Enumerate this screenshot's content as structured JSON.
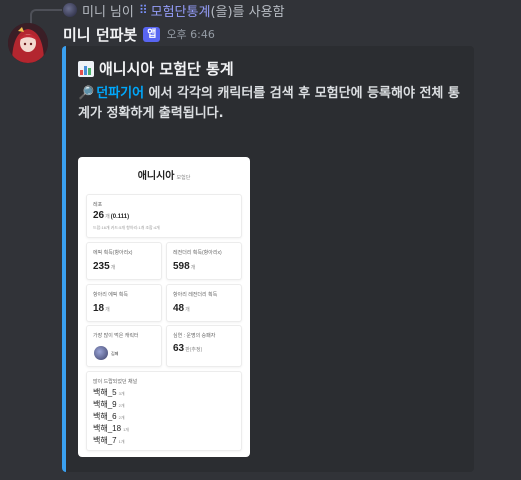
{
  "reply": {
    "user": "미니",
    "suffix_before": "님이",
    "command": "모험단통계",
    "suffix_after": "(을)를 사용함"
  },
  "message": {
    "author": "미니 던파봇",
    "badge": "앱",
    "timestamp": "오후 6:46"
  },
  "embed": {
    "accent_color": "#3aa0f0",
    "title_icon": "bar-chart-emoji",
    "title": "애니시아 모험단 통계",
    "desc_icon": "magnifier-emoji",
    "desc_link": "던파기어",
    "desc_text": " 에서 각각의 캐릭터를 검색 후 모험단에 등록해야 전체 통계가 정확하게 출력됩니다."
  },
  "card": {
    "title": "애니시아",
    "title_suffix": "모험단",
    "level_box": {
      "label": "레포",
      "value": "26",
      "unit": "개",
      "extra": "(0.111)",
      "sub": "드랍:16개 카드:5개 항아리:1개 조합:4개"
    },
    "epic_box": {
      "label": "에픽 획득(항아리x)",
      "value": "235",
      "unit": "개"
    },
    "legend_box": {
      "label": "레전더리 획득(항아리x)",
      "value": "598",
      "unit": "개"
    },
    "pot_epic_box": {
      "label": "항아리 에픽 획득",
      "value": "18",
      "unit": "개"
    },
    "pot_legend_box": {
      "label": "항아리 레전더리 획득",
      "value": "48",
      "unit": "개"
    },
    "top_char_box": {
      "label": "가장 많이 먹은 캐릭터",
      "name": "김페"
    },
    "mugaejung_box": {
      "label": "심연 : 운명의 승패자",
      "value": "63",
      "unit": "판(추정)"
    },
    "drop_list": {
      "label": "많이 드랍되었던 채널",
      "items": [
        {
          "name": "백해_5",
          "count": "3개"
        },
        {
          "name": "백해_9",
          "count": "2개"
        },
        {
          "name": "백해_6",
          "count": "2개"
        },
        {
          "name": "백해_18",
          "count": "1개"
        },
        {
          "name": "백해_7",
          "count": "1개"
        }
      ]
    }
  }
}
